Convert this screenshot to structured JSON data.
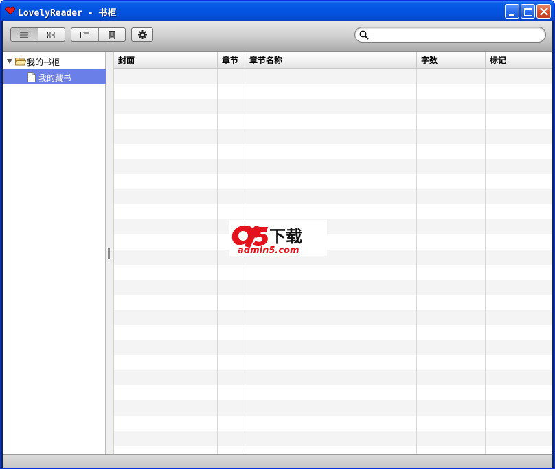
{
  "window": {
    "title": "LovelyReader - 书柜",
    "controls": {
      "minimize": "minimize",
      "maximize": "maximize",
      "close": "close"
    }
  },
  "toolbar": {
    "view_buttons": [
      {
        "icon": "list-view-icon",
        "active": true
      },
      {
        "icon": "grid-view-icon",
        "active": false
      }
    ],
    "file_buttons": [
      {
        "icon": "folder-icon"
      },
      {
        "icon": "bookmark-icon"
      }
    ],
    "settings_button": {
      "icon": "gear-icon"
    },
    "search": {
      "value": "",
      "placeholder": ""
    }
  },
  "sidebar": {
    "tree": [
      {
        "label": "我的书柜",
        "icon": "folder-open-icon",
        "expanded": true
      },
      {
        "label": "我的藏书",
        "icon": "document-icon",
        "selected": true
      }
    ]
  },
  "table": {
    "columns": [
      "封面",
      "章节",
      "章节名称",
      "字数",
      "标记"
    ],
    "rows": []
  },
  "watermark": {
    "text_big": "a5下载",
    "text_small": "admin5.com"
  },
  "colors": {
    "titlebar": "#0454e3",
    "selection": "#6a7fe8",
    "watermark_red": "#e4121a"
  }
}
